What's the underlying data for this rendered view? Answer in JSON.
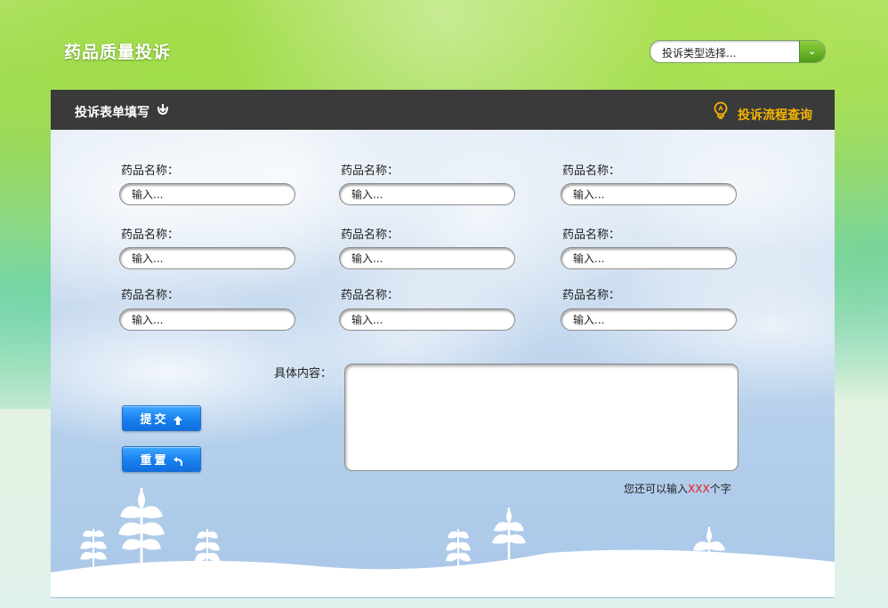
{
  "header": {
    "title": "药品质量投诉",
    "type_select": {
      "value": "投诉类型选择...",
      "icon": "chevron-down-icon"
    }
  },
  "panel": {
    "form_title": "投诉表单填写",
    "process_link": "投诉流程查询",
    "process_icon": "lightbulb-icon",
    "form_icon": "hand-down-icon",
    "fields": [
      {
        "label": "药品名称：",
        "placeholder": "输入..."
      },
      {
        "label": "药品名称：",
        "placeholder": "输入..."
      },
      {
        "label": "药品名称：",
        "placeholder": "输入..."
      },
      {
        "label": "药品名称：",
        "placeholder": "输入..."
      },
      {
        "label": "药品名称：",
        "placeholder": "输入..."
      },
      {
        "label": "药品名称：",
        "placeholder": "输入..."
      },
      {
        "label": "药品名称：",
        "placeholder": "输入..."
      },
      {
        "label": "药品名称：",
        "placeholder": "输入..."
      },
      {
        "label": "药品名称：",
        "placeholder": "输入..."
      }
    ],
    "content_label": "具体内容：",
    "char_hint_prefix": "您还可以输入",
    "char_hint_count": "XXX",
    "char_hint_suffix": "个字",
    "submit_label": "提交",
    "reset_label": "重置"
  },
  "colors": {
    "accent_orange": "#f5b400",
    "button_blue": "#1a83f0",
    "header_dark": "#3a3a3a",
    "hint_red": "#e8141b"
  }
}
